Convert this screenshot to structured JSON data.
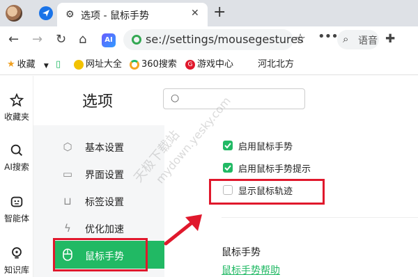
{
  "tab": {
    "title": "选项 - 鼠标手势",
    "close": "✕",
    "new_tab": "+"
  },
  "toolbar": {
    "ai_badge": "AI",
    "url": "se://settings/mousegestures",
    "search_placeholder": "语音",
    "more": "•••"
  },
  "bookmarks": [
    {
      "label": "收藏",
      "icon": "star-icon"
    },
    {
      "label": "网址大全",
      "icon": "yellow-logo-icon"
    },
    {
      "label": "360搜索",
      "icon": "360-logo-icon"
    },
    {
      "label": "游戏中心",
      "icon": "game-logo-icon"
    },
    {
      "label": "河北北方",
      "icon": "none"
    }
  ],
  "rail": [
    {
      "label": "收藏夹",
      "icon": "star-outline-icon"
    },
    {
      "label": "AI搜索",
      "icon": "search-icon"
    },
    {
      "label": "智能体",
      "icon": "robot-icon"
    },
    {
      "label": "知识库",
      "icon": "bulb-icon"
    }
  ],
  "settings": {
    "page_title": "选项",
    "nav": [
      {
        "label": "基本设置",
        "icon": "hexagon-icon"
      },
      {
        "label": "界面设置",
        "icon": "window-icon"
      },
      {
        "label": "标签设置",
        "icon": "tab-icon"
      },
      {
        "label": "优化加速",
        "icon": "lightning-icon"
      },
      {
        "label": "鼠标手势",
        "icon": "mouse-icon",
        "active": true
      }
    ],
    "options": [
      {
        "label": "启用鼠标手势",
        "checked": true
      },
      {
        "label": "启用鼠标手势提示",
        "checked": true
      },
      {
        "label": "显示鼠标轨迹",
        "checked": false
      }
    ],
    "section_title": "鼠标手势",
    "help_link": "鼠标手势帮助"
  },
  "watermark": {
    "line1": "天极下载站",
    "line2": "mydown.yesky.com"
  },
  "colors": {
    "accent": "#21b964",
    "highlight": "#e0182c",
    "tabstrip": "#dee1e6"
  }
}
